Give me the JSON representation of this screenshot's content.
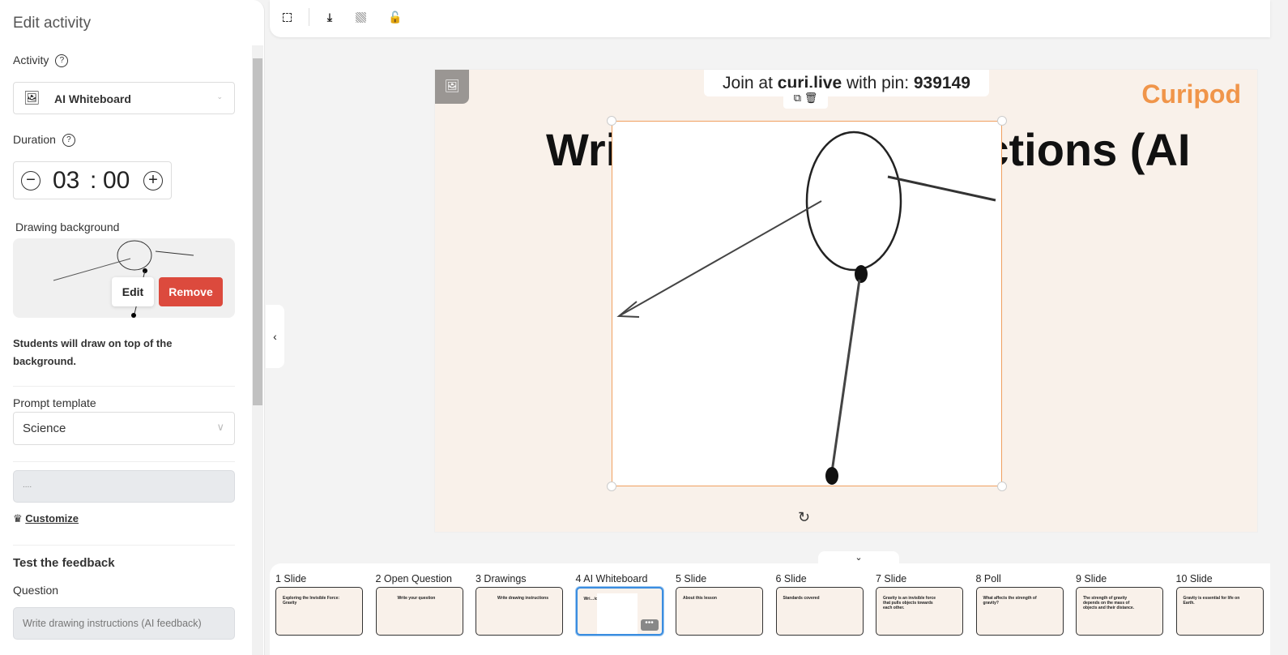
{
  "panel": {
    "title": "Edit activity",
    "activity_label": "Activity",
    "activity_value": "AI Whiteboard",
    "duration_label": "Duration",
    "minutes": "03",
    "seconds": "00",
    "drawing_bg_label": "Drawing background",
    "edit_label": "Edit",
    "remove_label": "Remove",
    "note": "Students will draw on top of the background.",
    "prompt_template_label": "Prompt template",
    "prompt_template_value": "Science",
    "prompt_text": "....",
    "customize_label": "Customize",
    "test_heading": "Test the feedback",
    "question_label": "Question",
    "question_value": "Write drawing instructions (AI feedback)"
  },
  "slide": {
    "join_prefix": "Join at ",
    "join_site": "curi.live",
    "join_mid": " with pin: ",
    "pin": "939149",
    "logo": "Curipod",
    "title": "Write drawing instructions (AI"
  },
  "filmstrip": [
    {
      "label": "1 Slide",
      "text": "Exploring the Invisible Force: Gravity"
    },
    {
      "label": "2 Open Question",
      "text": "Write your question"
    },
    {
      "label": "3 Drawings",
      "text": "Write drawing instructions"
    },
    {
      "label": "4 AI Whiteboard",
      "text": "Wri…ions (AI"
    },
    {
      "label": "5 Slide",
      "text": "About this lesson"
    },
    {
      "label": "6 Slide",
      "text": "Standards covered"
    },
    {
      "label": "7 Slide",
      "text": "Gravity is an invisible force that pulls objects towards each other."
    },
    {
      "label": "8 Poll",
      "text": "What affects the strength of gravity?"
    },
    {
      "label": "9 Slide",
      "text": "The strength of gravity depends on the mass of objects and their distance."
    },
    {
      "label": "10 Slide",
      "text": "Gravity is essential for life on Earth."
    }
  ],
  "colors": {
    "accent": "#f0954a",
    "remove": "#dc4a3d",
    "selected": "#3a8de0"
  }
}
